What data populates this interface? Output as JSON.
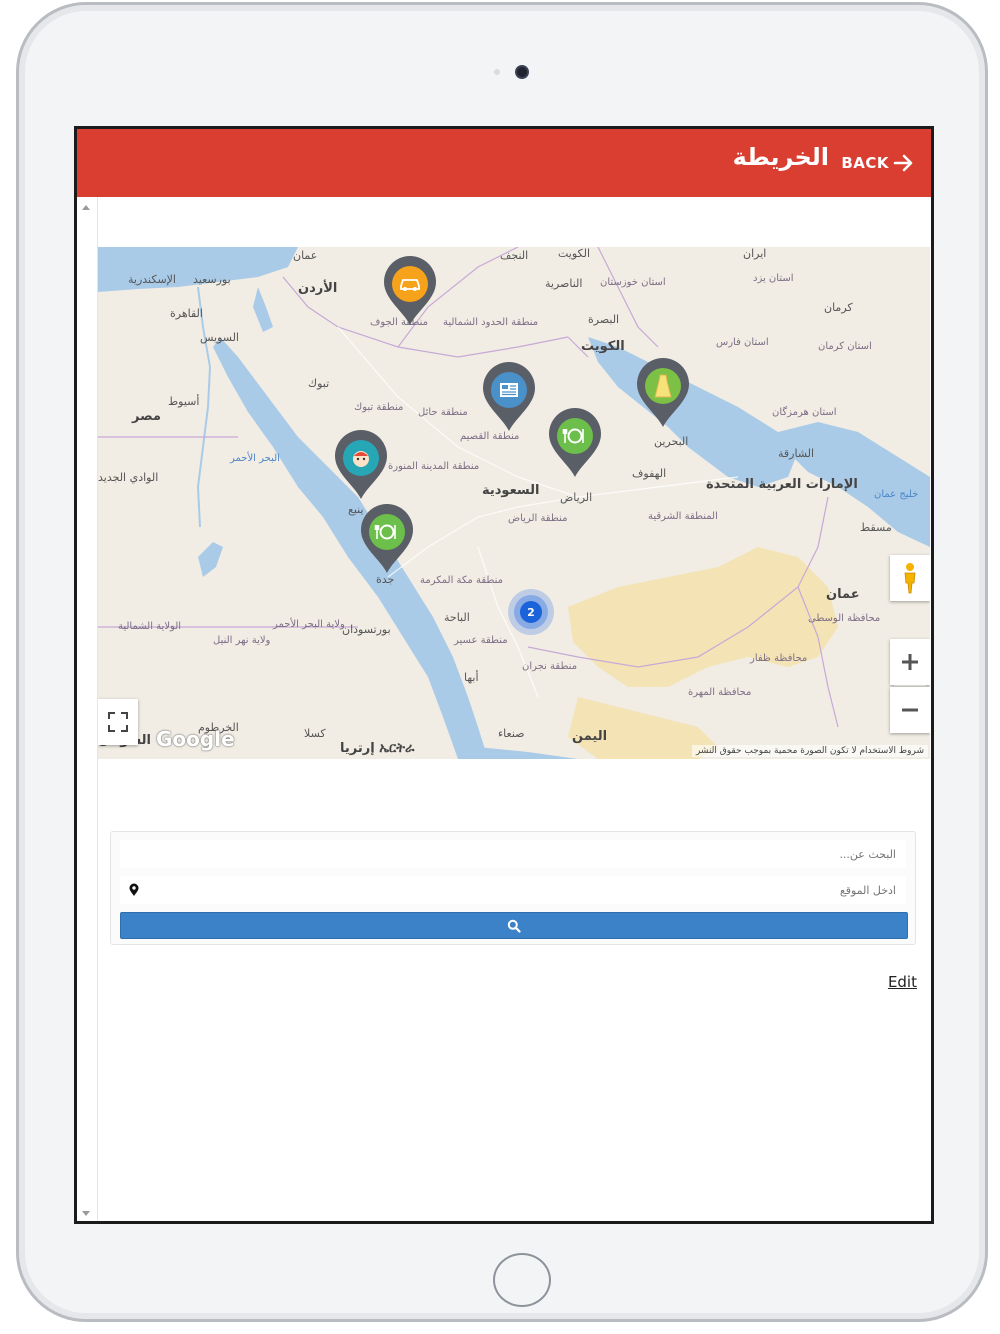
{
  "header": {
    "title": "الخريطة",
    "back_label": "BACK"
  },
  "map": {
    "labels": {
      "amman": "عمان",
      "jordan": "الأردن",
      "portsaid": "بورسعيد",
      "alexandria": "الإسكندرية",
      "cairo": "القاهرة",
      "suez": "السويس",
      "asyut": "أسيوط",
      "egypt": "مصر",
      "newvalley": "الوادي الجديد",
      "redsea": "البحر الأحمر",
      "tabuk": "تبوك",
      "tabuk_region": "منطقة تبوك",
      "hail_region": "منطقة حائل",
      "jouf": "منطقة الجوف",
      "northern_border": "منطقة الحدود الشمالية",
      "najaf": "النجف",
      "kuwait_city": "الكويت",
      "nasiriyah": "الناصرية",
      "basra": "البصرة",
      "kuwait": "الكويت",
      "khuzestan": "استان خوزستان",
      "iran": "ایران",
      "yazd": "استان یزد",
      "kerman": "كرمان",
      "kerman_prov": "استان كرمان",
      "fars": "استان فارس",
      "hormozgan": "استان هرمزگان",
      "qassim": "منطقة القصيم",
      "madinah_region": "منطقة المدينة المنورة",
      "yanbu": "ينبع",
      "saudi": "السعودية",
      "riyadh": "الرياض",
      "riyadh_region": "منطقة الرياض",
      "bahrain": "البحرين",
      "hofuf": "الهفوف",
      "eastern_region": "المنطقة الشرقية",
      "sharjah": "الشارقة",
      "uae": "الإمارات العربية المتحدة",
      "gulf_oman": "خليج عمان",
      "muscat": "مسقط",
      "oman": "عمان",
      "jeddah": "جدة",
      "makkah_region": "منطقة مكة المكرمة",
      "baha": "الباحة",
      "asir_region": "منطقة عسير",
      "najran_region": "منطقة نجران",
      "abha": "أبها",
      "portsudan": "بورتسودان",
      "redsea_state": "ولاية البحر الأحمر",
      "northern_state": "الولاية الشمالية",
      "nile_state": "ولاية نهر النيل",
      "khartoum": "الخرطوم",
      "sudan": "السودان",
      "kassala": "كسلا",
      "eritrea": "ኤርትራ إرتريا",
      "sanaa": "صنعاء",
      "yemen": "اليمن",
      "mahra": "محافظة المهرة",
      "dhofar": "محافظة ظفار",
      "wusta": "محافظة الوسطى"
    },
    "cluster_count": "2",
    "google_logo": "Google",
    "terms": "شروط الاستخدام   لا تكون الصورة محمية بموجب حقوق النشر",
    "colors": {
      "water": "#a9cbe8",
      "land": "#f1ede4",
      "desert": "#f4e3b5",
      "pin_orange": "#f7a21b",
      "pin_blue": "#4a90c9",
      "pin_green": "#6cbf4a",
      "pin_teal": "#27a6b5",
      "pin_yellowgreen": "#7cc046",
      "cluster": "#1a63d8"
    }
  },
  "search": {
    "query_placeholder": "البحث عن...",
    "location_placeholder": "ادخل الموقع"
  },
  "edit_label": "Edit",
  "theme": {
    "header_color": "#d93e30",
    "button_color": "#3b82c9"
  }
}
